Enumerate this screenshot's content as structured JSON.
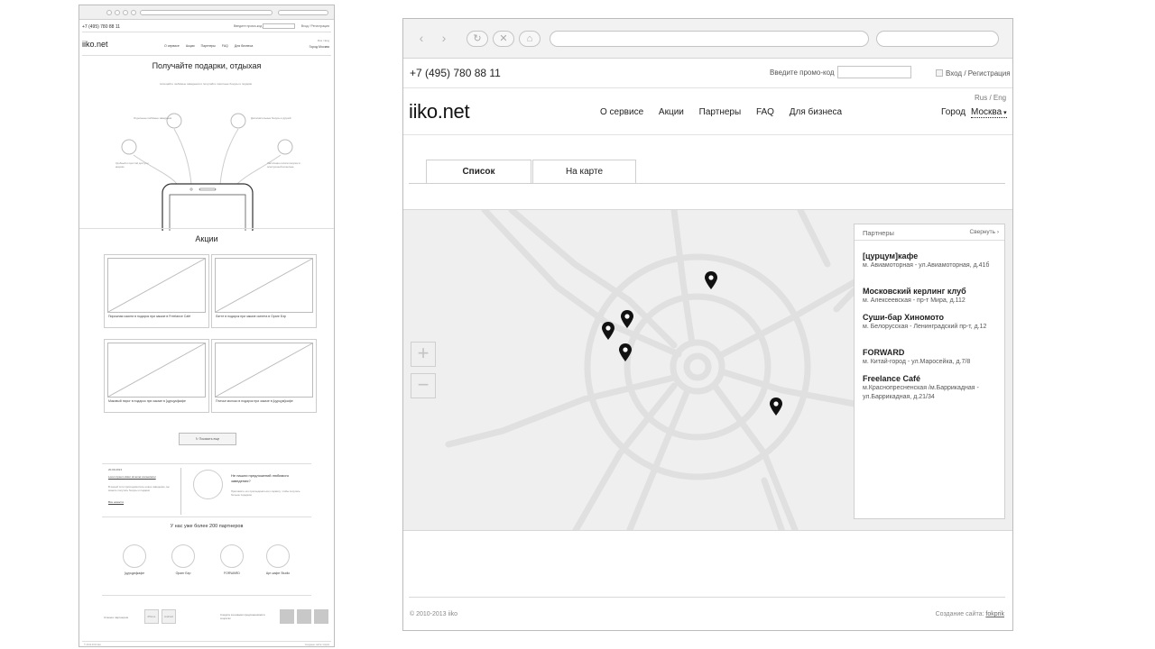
{
  "left_page": {
    "phone": "+7 (495) 780 88 11",
    "promo_label": "Введите промо-код",
    "login": "Вход / Регистрация",
    "logo": "iiko.net",
    "nav": [
      "О сервисе",
      "Акции",
      "Партнеры",
      "FAQ",
      "Для бизнеса"
    ],
    "lang": "Rus / Eng",
    "city": "Город Москва",
    "hero_title": "Получайте подарки, отдыхая",
    "hero_subtitle": "посещайте любимые заведения и получайте приятные бонусы и подарки",
    "hero_labels": [
      "Отдельные любимые заведения",
      "Дополнительные бонусы и друзей",
      "Удобный и простой доступ к акциям",
      "Частичная оплата покупок в электронной кошельке"
    ],
    "promotions_title": "Акции",
    "promotions": [
      "Пирожная сакити в подарок при заказе в Freelance Café",
      "Латте в подарок при заказе омлета в Оранг Бэр",
      "Маковый пирог в подарок при заказе в [цурцум]кафе",
      "Птичье молоко в подарок при заказе в [цурцум]кафе"
    ],
    "more_button": "Показать еще",
    "blog": {
      "date": "20.09.2013",
      "link": "Lorem Ipsum dolor sit amet consectetur",
      "text": "В нашей сети присоединилось новое заведение, вы можете получать бонусы и подарки",
      "more": "Все новости"
    },
    "ask": {
      "title": "Не нашли предложений любимого заведения?",
      "text": "Пригласите его присоединиться к сервису, чтобы получать больше подарков"
    },
    "partners_title": "У нас уже более 200 партнеров",
    "partners": [
      "[цурцум]кафе",
      "Оранг Бэр",
      "FORWARD",
      "Арт-кафе Studio"
    ],
    "footer_left": "Станьте партнером",
    "footer_btns": [
      "iPhone",
      "Android"
    ],
    "footer_mid": "Следите за новыми предложениями в соцсетях",
    "copyright": "© 2010-2013 iiko",
    "credits": "Создание сайта: fokprik"
  },
  "browser": {
    "back_icon": "arrow-left-icon",
    "forward_icon": "arrow-right-icon",
    "buttons": [
      "reload-icon",
      "stop-icon",
      "home-icon"
    ]
  },
  "topbar": {
    "phone": "+7 (495) 780 88 11",
    "promo_label": "Введите промо-код",
    "promo_value": "",
    "login": "Вход / Регистрация"
  },
  "header": {
    "logo": "iiko.net",
    "nav": [
      "О сервисе",
      "Акции",
      "Партнеры",
      "FAQ",
      "Для бизнеса"
    ],
    "lang": "Rus / Eng",
    "city_label": "Город",
    "city_value": "Москва"
  },
  "tabs": [
    {
      "label": "Список",
      "active": true
    },
    {
      "label": "На карте",
      "active": false
    }
  ],
  "map": {
    "zoom_in": "+",
    "zoom_out": "−",
    "marker_icon": "map-pin-icon",
    "markers": 5,
    "colors": {
      "background": "#efefef",
      "roads": "#e0e0e0",
      "marker": "#111111"
    }
  },
  "partners_panel": {
    "title": "Партнеры",
    "collapse": "Свернуть",
    "items": [
      {
        "name": "[цурцум]кафе",
        "address": "м. Авиамоторная - ул.Авиамоторная, д.41б"
      },
      {
        "name": "Московский керлинг клуб",
        "address": "м. Алексеевская - пр-т Мира, д.112"
      },
      {
        "name": "Суши-бар Хиномото",
        "address": "м. Белорусская - Ленинградский пр-т, д.12"
      },
      {
        "name": "FORWARD",
        "address": "м. Китай-город - ул.Маросейка, д.7/8"
      },
      {
        "name": "Freelance Café",
        "address": "м.Краснопресненская /м.Баррикадная - ул.Баррикадная, д.21/34"
      }
    ]
  },
  "footer": {
    "copyright": "© 2010-2013 iiko",
    "credits_label": "Создание сайта:",
    "credits_link": "fokprik"
  }
}
